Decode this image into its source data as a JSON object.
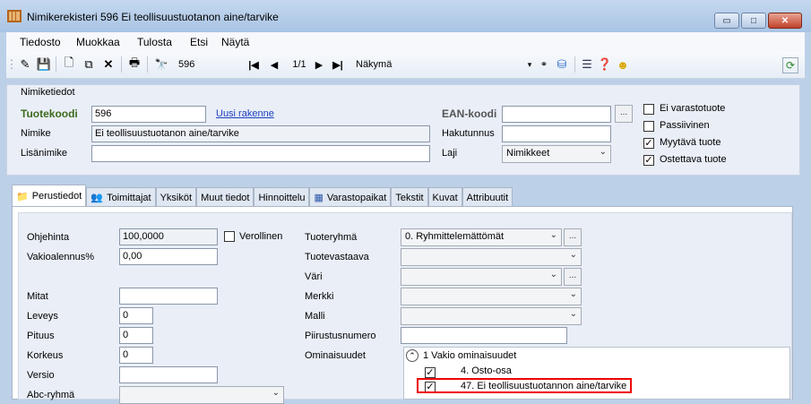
{
  "window": {
    "title": "Nimikerekisteri 596 Ei teollisuustuotanon aine/tarvike",
    "controls": {
      "minimize": "▭",
      "maximize": "□",
      "close": "✕"
    }
  },
  "menu": [
    "Tiedosto",
    "Muokkaa",
    "Tulosta",
    "Etsi",
    "Näytä"
  ],
  "toolbar": {
    "record_code": "596",
    "pager": "1/1",
    "view_label": "Näkymä"
  },
  "header": {
    "section_title": "Nimiketiedot",
    "tuotekoodi_label": "Tuotekoodi",
    "tuotekoodi_value": "596",
    "new_structure_link": "Uusi rakenne",
    "nimike_label": "Nimike",
    "nimike_value": "Ei teollisuustuotanon aine/tarvike",
    "lisanimike_label": "Lisänimike",
    "lisanimike_value": "",
    "ean_label": "EAN-koodi",
    "ean_value": "",
    "ean_btn": "...",
    "hakutunnus_label": "Hakutunnus",
    "hakutunnus_value": "",
    "laji_label": "Laji",
    "laji_value": "Nimikkeet",
    "checks": [
      {
        "label": "Ei varastotuote",
        "checked": false
      },
      {
        "label": "Passiivinen",
        "checked": false
      },
      {
        "label": "Myytävä tuote",
        "checked": true
      },
      {
        "label": "Ostettava tuote",
        "checked": true
      }
    ]
  },
  "tabs": [
    "Perustiedot",
    "Toimittajat",
    "Yksiköt",
    "Muut tiedot",
    "Hinnoittelu",
    "Varastopaikat",
    "Tekstit",
    "Kuvat",
    "Attribuutit"
  ],
  "perustiedot": {
    "ohjehinta_label": "Ohjehinta",
    "ohjehinta_value": "100,0000",
    "verollinen_label": "Verollinen",
    "vakioalennus_label": "Vakioalennus%",
    "vakioalennus_value": "0,00",
    "mitat_label": "Mitat",
    "mitat_value": "",
    "leveys_label": "Leveys",
    "leveys_value": "0",
    "pituus_label": "Pituus",
    "pituus_value": "0",
    "korkeus_label": "Korkeus",
    "korkeus_value": "0",
    "versio_label": "Versio",
    "versio_value": "",
    "abc_label": "Abc-ryhmä",
    "abc_value": "",
    "tuoteryhma_label": "Tuoteryhmä",
    "tuoteryhma_value": "0. Ryhmittelemättömät",
    "tuotevastaava_label": "Tuotevastaava",
    "tuotevastaava_value": "",
    "vari_label": "Väri",
    "vari_value": "",
    "merkki_label": "Merkki",
    "merkki_value": "",
    "malli_label": "Malli",
    "malli_value": "",
    "piirustusnumero_label": "Piirustusnumero",
    "piirustusnumero_value": "",
    "ominaisuudet_label": "Ominaisuudet",
    "tree_group": "1 Vakio ominaisuudet",
    "tree_items": [
      {
        "label": "4. Osto-osa",
        "checked": true
      },
      {
        "label": "47. Ei teollisuustuotannon aine/tarvike",
        "checked": true
      }
    ]
  }
}
